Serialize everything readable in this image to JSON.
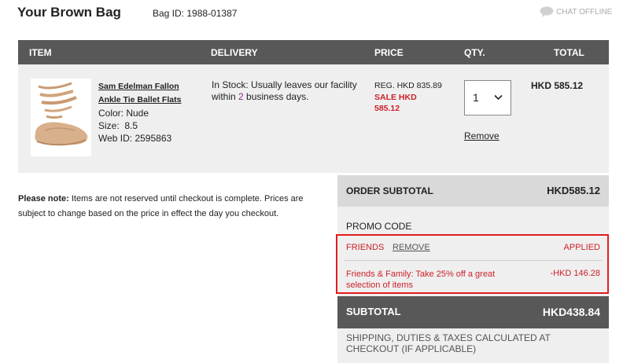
{
  "header": {
    "title": "Your Brown Bag",
    "bag_id": "Bag ID: 1988-01387",
    "chat_status": "CHAT OFFLINE",
    "chat_icon": "speech-bubble-icon"
  },
  "table_headers": {
    "item": "ITEM",
    "delivery": "DELIVERY",
    "price": "PRICE",
    "qty": "QTY.",
    "total": "TOTAL"
  },
  "item": {
    "name_line1": "Sam Edelman Fallon",
    "name_line2": "Ankle Tie Ballet Flats",
    "color": "Color: Nude",
    "size": "Size:  8.5",
    "web_id": "Web ID: 2595863",
    "delivery_pre": "In Stock: Usually leaves our facility within ",
    "delivery_days": "2",
    "delivery_post": " business days.",
    "reg_price": "REG. HKD 835.89",
    "sale_price_line1": "SALE HKD",
    "sale_price_line2": "585.12",
    "qty": "1",
    "remove": "Remove",
    "total": "HKD 585.12",
    "image_icon": "shoe-image",
    "image_color": "#d9b08c"
  },
  "note": {
    "label": "Please note:",
    "text": " Items are not reserved until checkout is complete. Prices are subject to change based on the price in effect the day you checkout."
  },
  "summary": {
    "order_subtotal_label": "ORDER SUBTOTAL",
    "order_subtotal_value": "HKD585.12",
    "promo_label": "PROMO CODE",
    "promo_code": "FRIENDS",
    "promo_remove": "REMOVE",
    "promo_status": "APPLIED",
    "promo_description": "Friends & Family: Take 25% off a great selection of items",
    "promo_discount": "-HKD 146.28",
    "subtotal_label": "SUBTOTAL",
    "subtotal_value": "HKD438.84",
    "tax_note": "SHIPPING, DUTIES & TAXES CALCULATED AT CHECKOUT (IF APPLICABLE)"
  },
  "colors": {
    "header_bar": "#585858",
    "panel_bg": "#efefef",
    "sale_red": "#cc2229",
    "highlight_border": "#e21c1c"
  }
}
